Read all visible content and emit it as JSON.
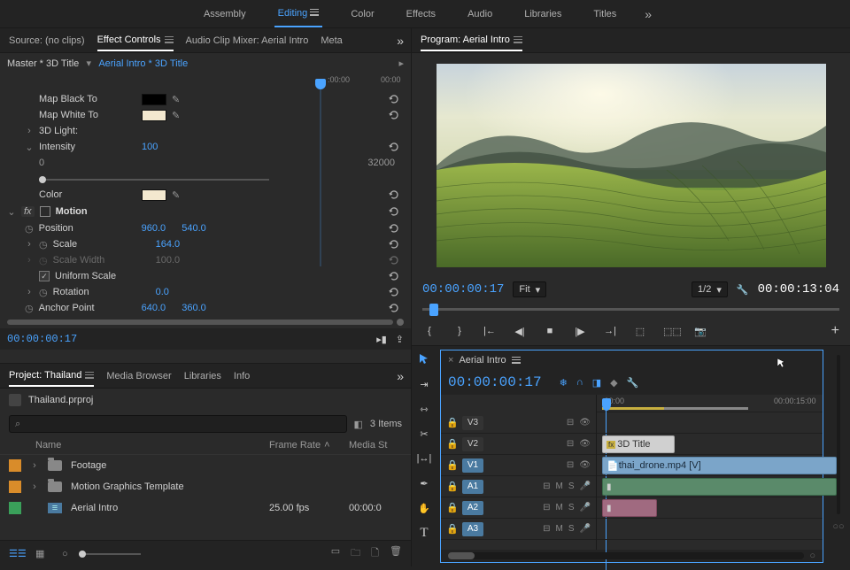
{
  "workspace": {
    "items": [
      "Assembly",
      "Editing",
      "Color",
      "Effects",
      "Audio",
      "Libraries",
      "Titles"
    ],
    "active": 1
  },
  "source_tabs": {
    "source": "Source: (no clips)",
    "effect_controls": "Effect Controls",
    "mixer": "Audio Clip Mixer: Aerial Intro",
    "metadata": "Meta"
  },
  "ec": {
    "master": "Master * 3D Title",
    "sequence": "Aerial Intro * 3D Title",
    "ruler_start": ":00:00",
    "ruler_mid": "00:00",
    "map_black": "Map Black To",
    "map_white": "Map White To",
    "threeD": "3D Light:",
    "intensity": "Intensity",
    "intensity_val": "100",
    "slider_min": "0",
    "slider_max": "32000",
    "color": "Color",
    "motion": "Motion",
    "position": "Position",
    "pos_x": "960.0",
    "pos_y": "540.0",
    "scale": "Scale",
    "scale_val": "164.0",
    "scale_w": "Scale Width",
    "scale_w_val": "100.0",
    "uniform": "Uniform Scale",
    "rotation": "Rotation",
    "rot_val": "0.0",
    "anchor": "Anchor Point",
    "anchor_x": "640.0",
    "anchor_y": "360.0",
    "timecode": "00:00:00:17"
  },
  "project": {
    "tabs": {
      "project": "Project: Thailand",
      "media": "Media Browser",
      "libs": "Libraries",
      "info": "Info"
    },
    "file": "Thailand.prproj",
    "count": "3 Items",
    "cols": {
      "name": "Name",
      "fps": "Frame Rate",
      "start": "Media St"
    },
    "items": [
      {
        "label": "orange",
        "type": "folder",
        "name": "Footage",
        "fps": "",
        "start": ""
      },
      {
        "label": "orange",
        "type": "folder",
        "name": "Motion Graphics Template",
        "fps": "",
        "start": ""
      },
      {
        "label": "green",
        "type": "seq",
        "name": "Aerial Intro",
        "fps": "25.00 fps",
        "start": "00:00:0"
      }
    ]
  },
  "program": {
    "title": "Program: Aerial Intro",
    "tc": "00:00:00:17",
    "fit": "Fit",
    "scale": "1/2",
    "dur": "00:00:13:04"
  },
  "timeline": {
    "name": "Aerial Intro",
    "tc": "00:00:00:17",
    "ruler": {
      "t1": ":00:00",
      "t2": "00:00:15:00"
    },
    "tracks": {
      "v3": "V3",
      "v2": "V2",
      "v1": "V1",
      "a1": "A1",
      "a2": "A2",
      "a3": "A3"
    },
    "clips": {
      "title": "3D Title",
      "v1": "thai_drone.mp4 [V]"
    },
    "ms": {
      "m": "M",
      "s": "S"
    }
  }
}
